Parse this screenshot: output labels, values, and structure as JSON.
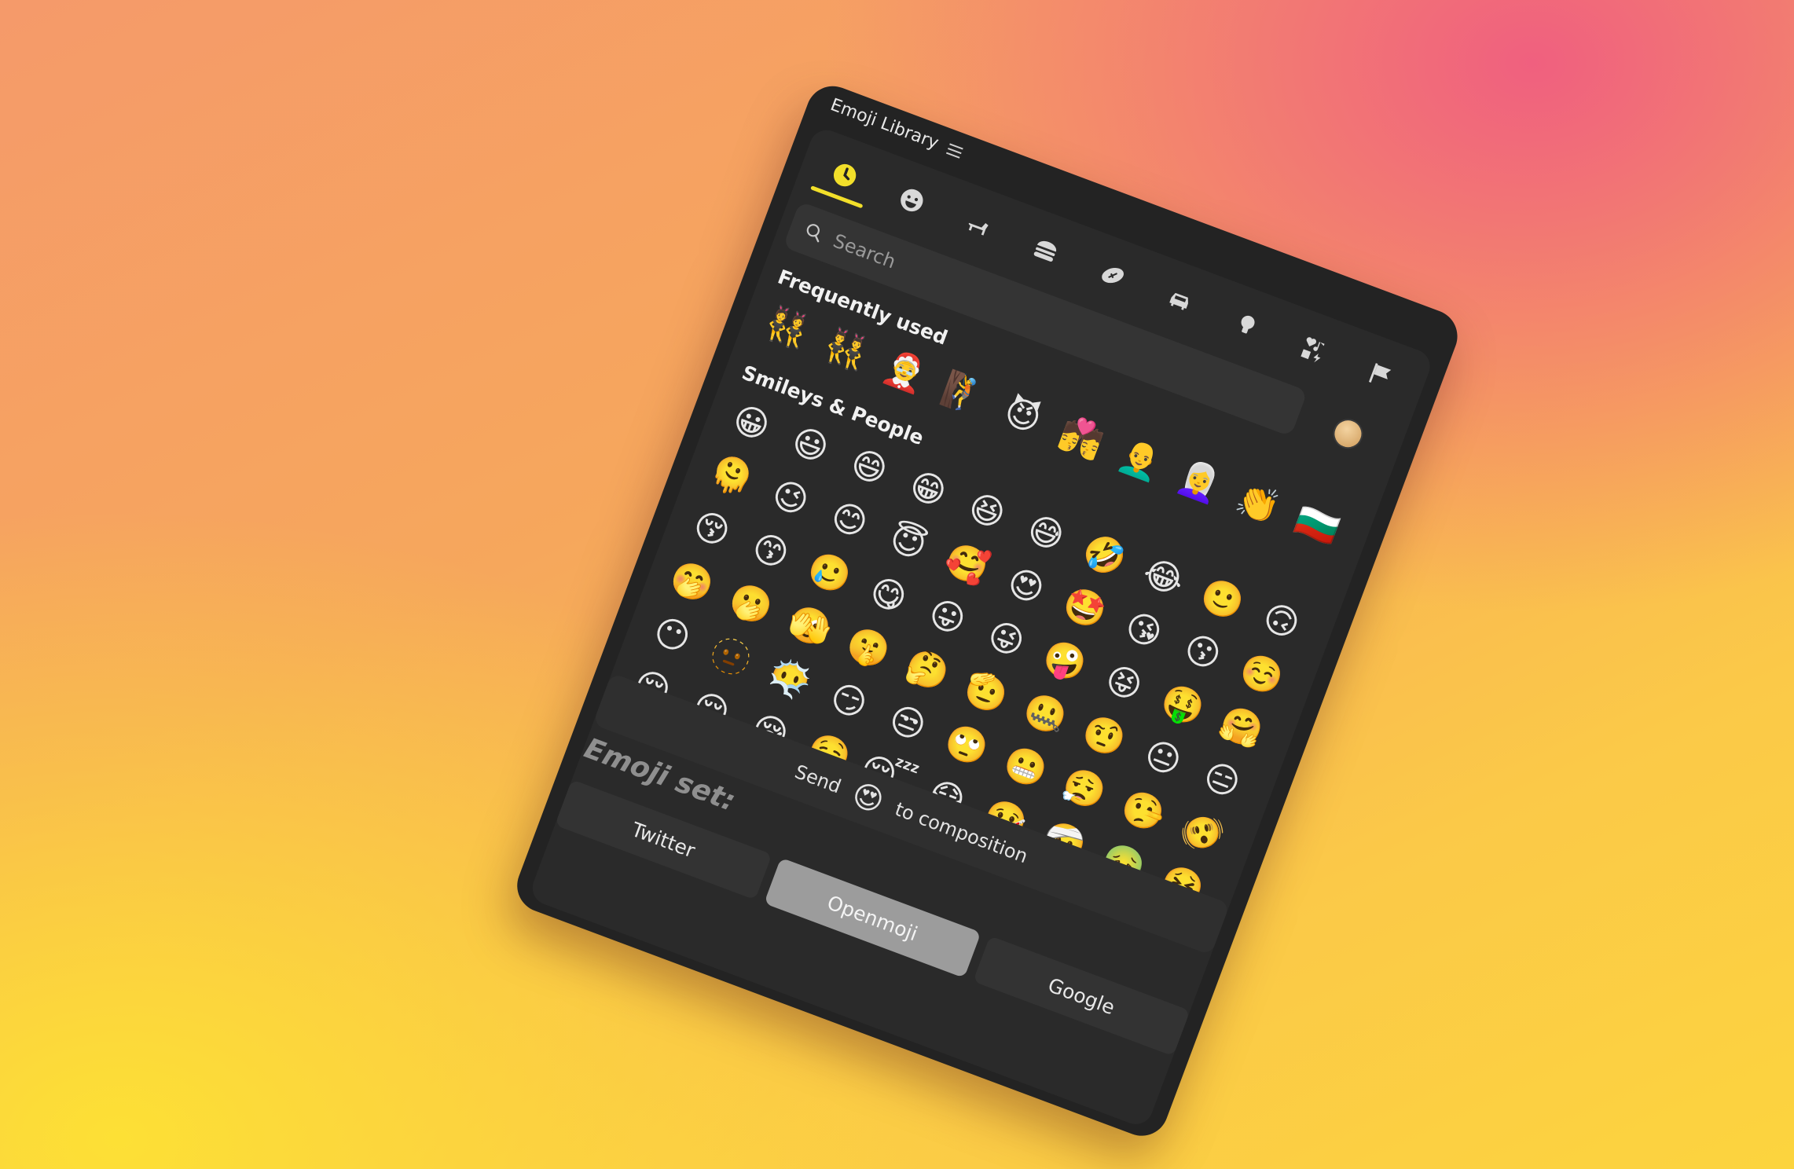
{
  "window": {
    "title": "Emoji Library",
    "menu_icon": "hamburger-menu-icon"
  },
  "tabs": [
    {
      "name": "recent",
      "icon": "clock-icon",
      "active": true
    },
    {
      "name": "smileys",
      "icon": "smiley-icon",
      "active": false
    },
    {
      "name": "animals",
      "icon": "dog-icon",
      "active": false
    },
    {
      "name": "food",
      "icon": "burger-icon",
      "active": false
    },
    {
      "name": "activities",
      "icon": "football-icon",
      "active": false
    },
    {
      "name": "travel",
      "icon": "car-icon",
      "active": false
    },
    {
      "name": "objects",
      "icon": "lightbulb-icon",
      "active": false
    },
    {
      "name": "symbols",
      "icon": "symbols-icon",
      "active": false
    },
    {
      "name": "flags",
      "icon": "flag-icon",
      "active": false
    }
  ],
  "search": {
    "placeholder": "Search",
    "value": ""
  },
  "skin_tone": {
    "color": "#d9a866"
  },
  "sections": {
    "frequently_used": {
      "title": "Frequently used",
      "emojis": [
        "👯",
        "👯‍♂️",
        "🤶",
        "🧗",
        "😈",
        "💏",
        "👨‍🦲",
        "👩‍🦳",
        "👏",
        "🇧🇬"
      ]
    },
    "smileys_people": {
      "title": "Smileys & People",
      "emojis": [
        "😀",
        "😃",
        "😄",
        "😁",
        "😆",
        "😅",
        "🤣",
        "😂",
        "🙂",
        "🙃",
        "🫠",
        "😉",
        "😊",
        "😇",
        "🥰",
        "😍",
        "🤩",
        "😘",
        "😗",
        "☺️",
        "😚",
        "😙",
        "🥲",
        "😋",
        "😛",
        "😜",
        "🤪",
        "😝",
        "🤑",
        "🤗",
        "🤭",
        "🫢",
        "🫣",
        "🤫",
        "🤔",
        "🫡",
        "🤐",
        "🤨",
        "😐",
        "😑",
        "😶",
        "🫥",
        "😶‍🌫️",
        "😏",
        "😒",
        "🙄",
        "😬",
        "😮‍💨",
        "🤥",
        "🫨",
        "😌",
        "😔",
        "😪",
        "🤤",
        "😴",
        "😷",
        "🤒",
        "🤕",
        "🤢",
        "🤮"
      ]
    }
  },
  "footer": {
    "send_label": "Send",
    "selected_emoji": "😍",
    "composition_label": "to composition"
  },
  "emoji_set": {
    "label": "Emoji set:",
    "options": [
      {
        "label": "Twitter",
        "active": false
      },
      {
        "label": "Openmoji",
        "active": true
      },
      {
        "label": "Google",
        "active": false
      }
    ]
  },
  "colors": {
    "accent": "#f2df2a",
    "panel": "#232323",
    "inner": "#2a2a2a"
  }
}
